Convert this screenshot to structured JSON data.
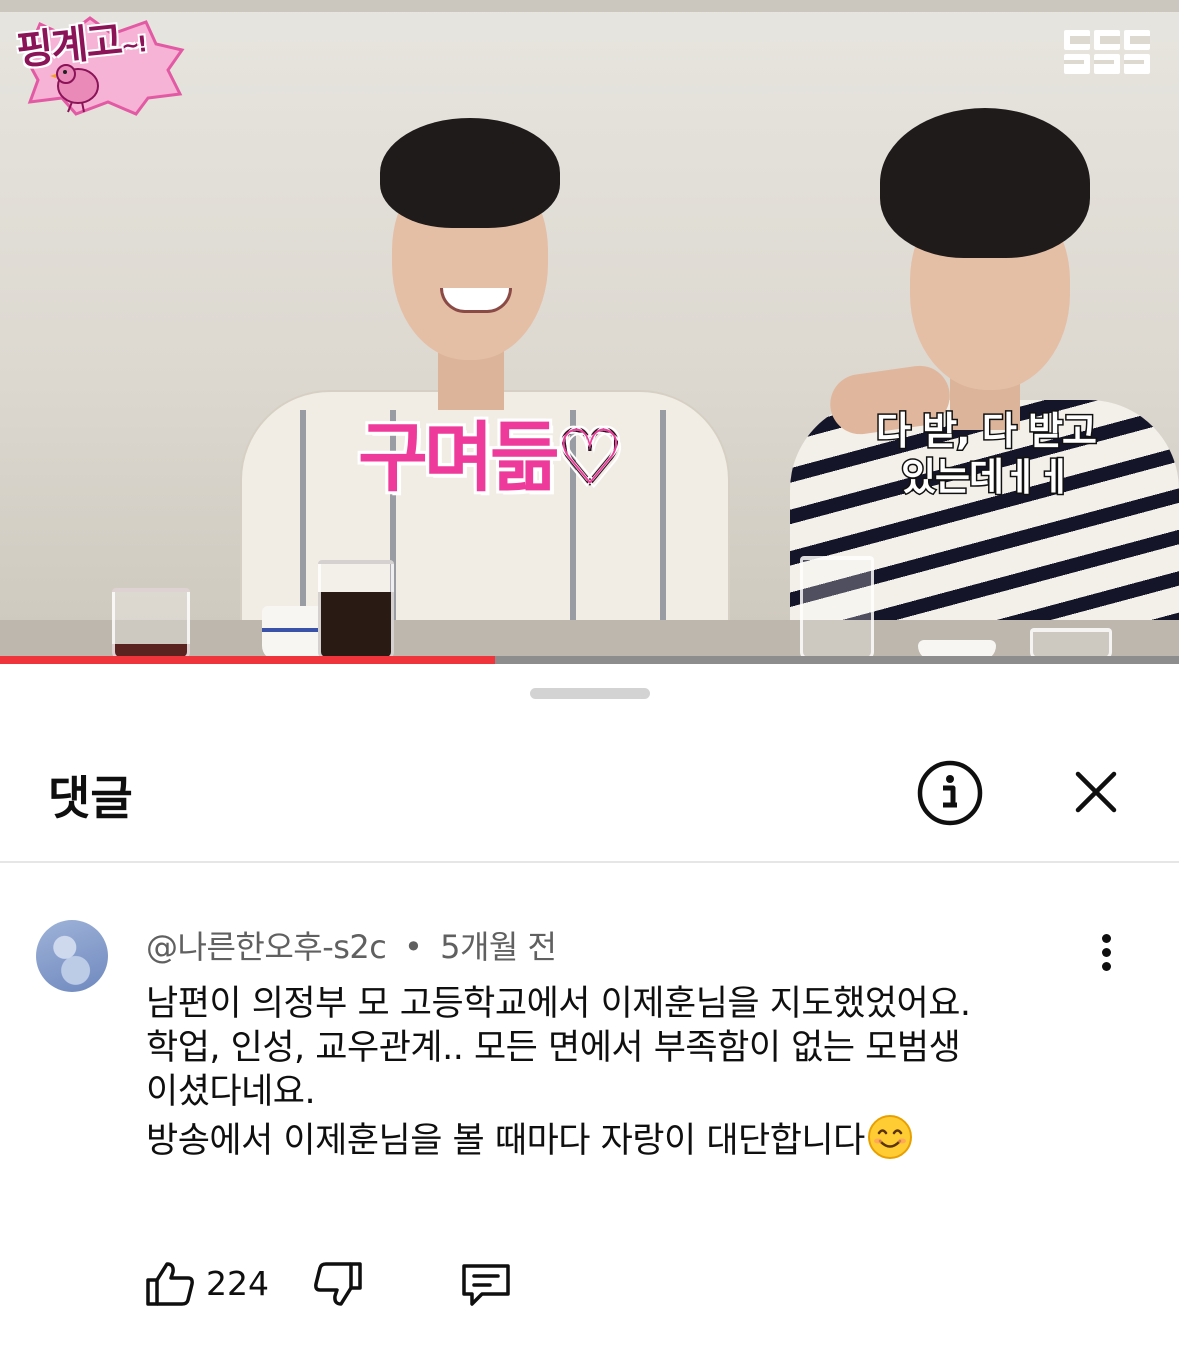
{
  "video": {
    "logo_text": "핑계고",
    "logo_suffix": "~!",
    "brand_mark": "뜬뜬",
    "caption_main": "구며듦♡",
    "caption_sub_lines": [
      "다 받, 다 받고",
      "있는데ㅔㅔ"
    ],
    "progress_fraction": 0.42
  },
  "sheet": {
    "title": "댓글",
    "info_icon": "info-circle-icon",
    "close_icon": "close-icon"
  },
  "comment": {
    "author": "@나른한오후-s2c",
    "separator": "•",
    "time": "5개월 전",
    "lines": [
      "남편이 의정부 모 고등학교에서 이제훈님을 지도했었어요.",
      "학업, 인성, 교우관계.. 모든 면에서 부족함이 없는 모범생",
      "이셨다네요.",
      "방송에서 이제훈님을 볼 때마다 자랑이 대단합니다"
    ],
    "emoji": "smiling-face-icon",
    "like_count": "224",
    "icons": [
      "thumbs-up-icon",
      "thumbs-down-icon",
      "reply-icon",
      "more-vertical-icon"
    ]
  },
  "colors": {
    "progress_played": "#f0343c",
    "caption_pink": "#ee3a9a",
    "text_primary": "#0f0f0f",
    "text_secondary": "#606060"
  }
}
